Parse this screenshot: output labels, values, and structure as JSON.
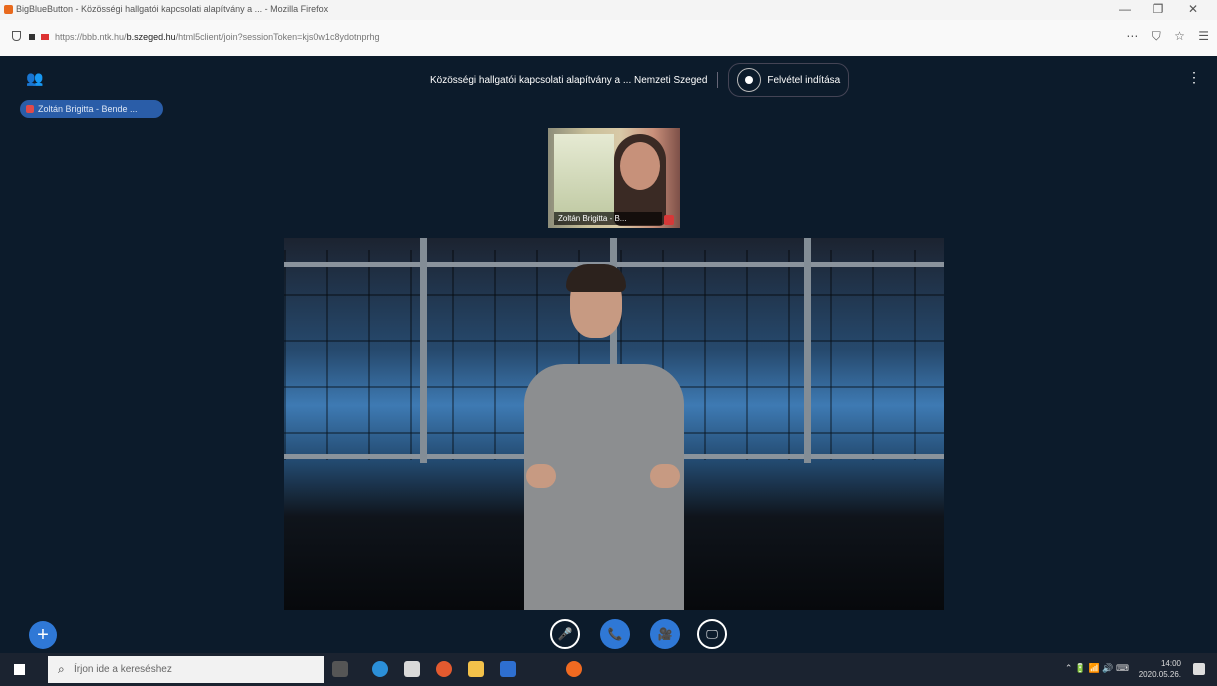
{
  "browser": {
    "window_title": "BigBlueButton - Közösségi hallgatói kapcsolati alapítvány a ... - Mozilla Firefox",
    "url_prefix": "https://bbb.ntk.hu/",
    "url_domain": "b.szeged.hu",
    "url_rest": "/html5client/join?sessionToken=kjs0w1c8ydotnprhg",
    "window_controls": [
      "—",
      "❐",
      "✕"
    ],
    "url_icons": [
      "⋯",
      "⛉",
      "☆",
      "☰"
    ]
  },
  "meeting": {
    "title": "Közösségi hallgatói kapcsolati alapítvány a ... Nemzeti Szeged",
    "record_label": "Felvétel indítása",
    "users_icon": "👥",
    "menu_icon": "⋮",
    "presenter_name": "Zoltán Brigitta - Bende ...",
    "webcam_name": "Zoltán Brigitta - B..."
  },
  "controls": {
    "plus": "+",
    "mic": "🎤",
    "phone": "📞",
    "camera": "🎥",
    "screen": "🖵"
  },
  "taskbar": {
    "search_placeholder": "Írjon ide a kereséshez",
    "tray": "⌃ 🔋 📶 🔊 ⌨",
    "clock_time": "14:00",
    "clock_date": "2020.05.26."
  },
  "colors": {
    "app_bg": "#0c1b2b",
    "accent_blue": "#2f78d6",
    "mute_red": "#d63838"
  }
}
